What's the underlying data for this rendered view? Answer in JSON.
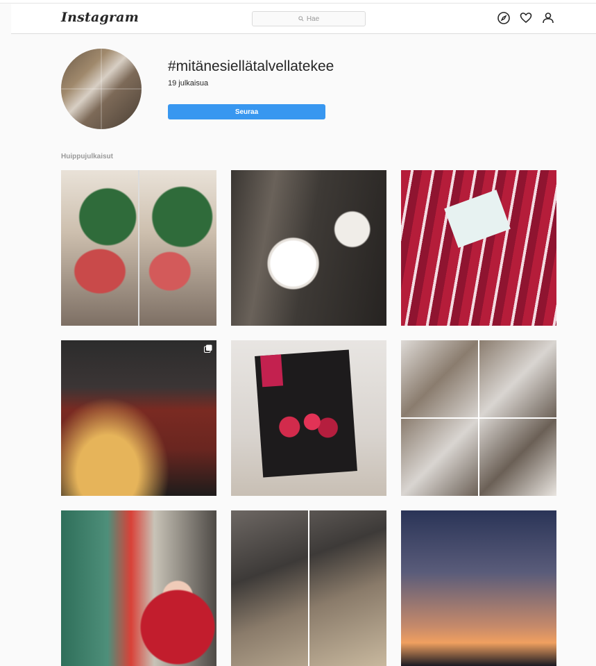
{
  "header": {
    "logo": "Instagram",
    "search_placeholder": "Hae",
    "icons": [
      "compass-icon",
      "heart-icon",
      "user-icon"
    ]
  },
  "profile": {
    "hashtag": "#mitänesiellätalvellatekee",
    "post_count": "19 julkaisua",
    "follow_label": "Seuraa"
  },
  "section": {
    "label": "Huippujulkaisut"
  },
  "colors": {
    "accent": "#3897f0",
    "background": "#fafafa",
    "text": "#262626",
    "muted": "#999999"
  }
}
